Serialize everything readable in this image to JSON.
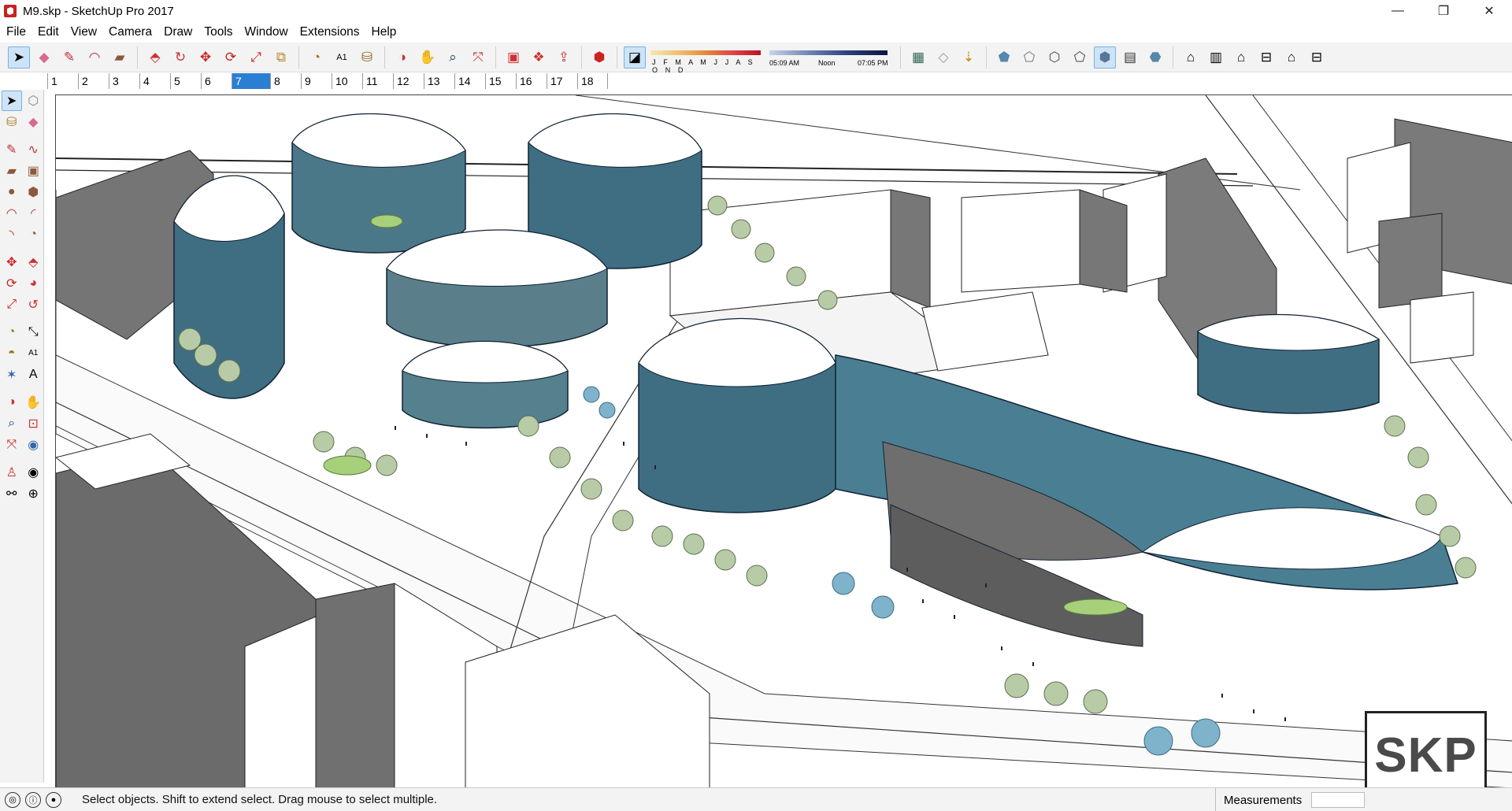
{
  "window": {
    "title": "M9.skp - SketchUp Pro 2017",
    "minimize_glyph": "—",
    "maximize_glyph": "❐",
    "close_glyph": "✕"
  },
  "menu": {
    "items": [
      {
        "label": "File"
      },
      {
        "label": "Edit"
      },
      {
        "label": "View"
      },
      {
        "label": "Camera"
      },
      {
        "label": "Draw"
      },
      {
        "label": "Tools"
      },
      {
        "label": "Window"
      },
      {
        "label": "Extensions"
      },
      {
        "label": "Help"
      }
    ]
  },
  "shadow_settings": {
    "months": "J F M A M J J A S O N D",
    "time_start": "05:09 AM",
    "time_mid": "Noon",
    "time_end": "07:05 PM"
  },
  "scenes": {
    "tabs": [
      {
        "label": "1"
      },
      {
        "label": "2"
      },
      {
        "label": "3"
      },
      {
        "label": "4"
      },
      {
        "label": "5"
      },
      {
        "label": "6"
      },
      {
        "label": "7"
      },
      {
        "label": "8"
      },
      {
        "label": "9"
      },
      {
        "label": "10"
      },
      {
        "label": "11"
      },
      {
        "label": "12"
      },
      {
        "label": "13"
      },
      {
        "label": "14"
      },
      {
        "label": "15"
      },
      {
        "label": "16"
      },
      {
        "label": "17"
      },
      {
        "label": "18"
      }
    ],
    "active": "7"
  },
  "watermark": {
    "text": "SKP"
  },
  "status": {
    "message": "Select objects. Shift to extend select. Drag mouse to select multiple.",
    "measurements_label": "Measurements",
    "measurements_value": ""
  },
  "colors": {
    "glass": "#3f6e82",
    "glass_light": "#7aa7b6",
    "roof": "#ffffff",
    "shade": "#6f6f6f",
    "tree": "#b7cca6",
    "grass": "#a6d07a",
    "accent_tab": "#2a7fd4"
  }
}
